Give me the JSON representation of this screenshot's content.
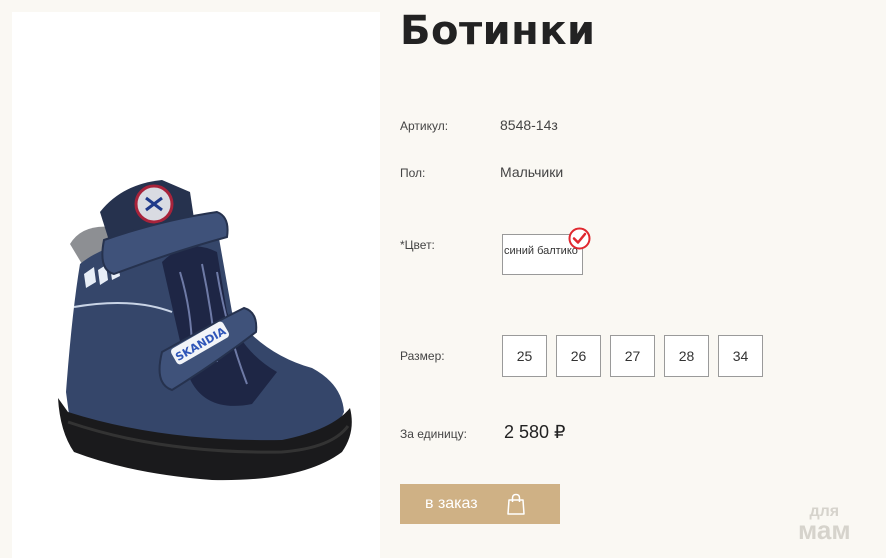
{
  "product": {
    "title": "Ботинки",
    "article_label": "Артикул:",
    "article_value": "8548-14з",
    "gender_label": "Пол:",
    "gender_value": "Мальчики",
    "color_label": "*Цвет:",
    "color_option": "синий балтико",
    "size_label": "Размер:",
    "sizes": [
      "25",
      "26",
      "27",
      "28",
      "34"
    ],
    "unit_price_label": "За единицу:",
    "price": "2 580 ₽"
  },
  "actions": {
    "order_label": "в заказ"
  },
  "photo": {
    "brand_label": "SKANDIA"
  },
  "watermark": {
    "line1": "для",
    "line2": "мам"
  },
  "colors": {
    "background": "#faf8f3",
    "button": "#cfb185",
    "check": "#e0282f",
    "boot": "#3a4a6b"
  }
}
